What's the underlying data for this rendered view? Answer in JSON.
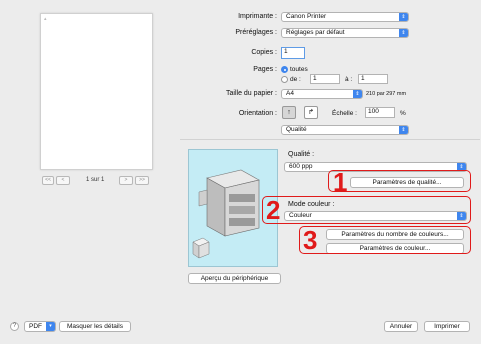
{
  "preview": {
    "page_indicator": "1 sur 1",
    "nav": {
      "first": "<<",
      "prev": "<",
      "next": ">",
      "last": ">>"
    }
  },
  "printer": {
    "label": "Imprimante :",
    "value": "Canon Printer"
  },
  "presets": {
    "label": "Préréglages :",
    "value": "Réglages par défaut"
  },
  "copies": {
    "label": "Copies :",
    "value": "1"
  },
  "pages": {
    "label": "Pages :",
    "all_label": "toutes",
    "from_label": "de :",
    "from_value": "1",
    "to_label": "à :",
    "to_value": "1"
  },
  "paper": {
    "label": "Taille du papier :",
    "value": "A4",
    "dimensions": "210 par 297 mm"
  },
  "orientation": {
    "label": "Orientation :",
    "portrait_glyph": "↑",
    "landscape_glyph": "↱"
  },
  "scale": {
    "label": "Échelle :",
    "value": "100",
    "unit": "%"
  },
  "panel_select": {
    "value": "Qualité"
  },
  "quality": {
    "label": "Qualité :",
    "value": "600 ppp",
    "settings_button": "Paramètres de qualité..."
  },
  "color_mode": {
    "label": "Mode couleur :",
    "value": "Couleur",
    "count_button": "Paramètres du nombre de couleurs...",
    "color_button": "Paramètres de couleur..."
  },
  "device_preview_button": "Aperçu du périphérique",
  "callouts": [
    "1",
    "2",
    "3"
  ],
  "footer": {
    "help": "?",
    "pdf": "PDF",
    "details": "Masquer les détails",
    "cancel": "Annuler",
    "print": "Imprimer"
  },
  "colors": {
    "accent": "#3f86ee",
    "callout": "#e01a1a",
    "device_bg": "#c4ecf5"
  }
}
